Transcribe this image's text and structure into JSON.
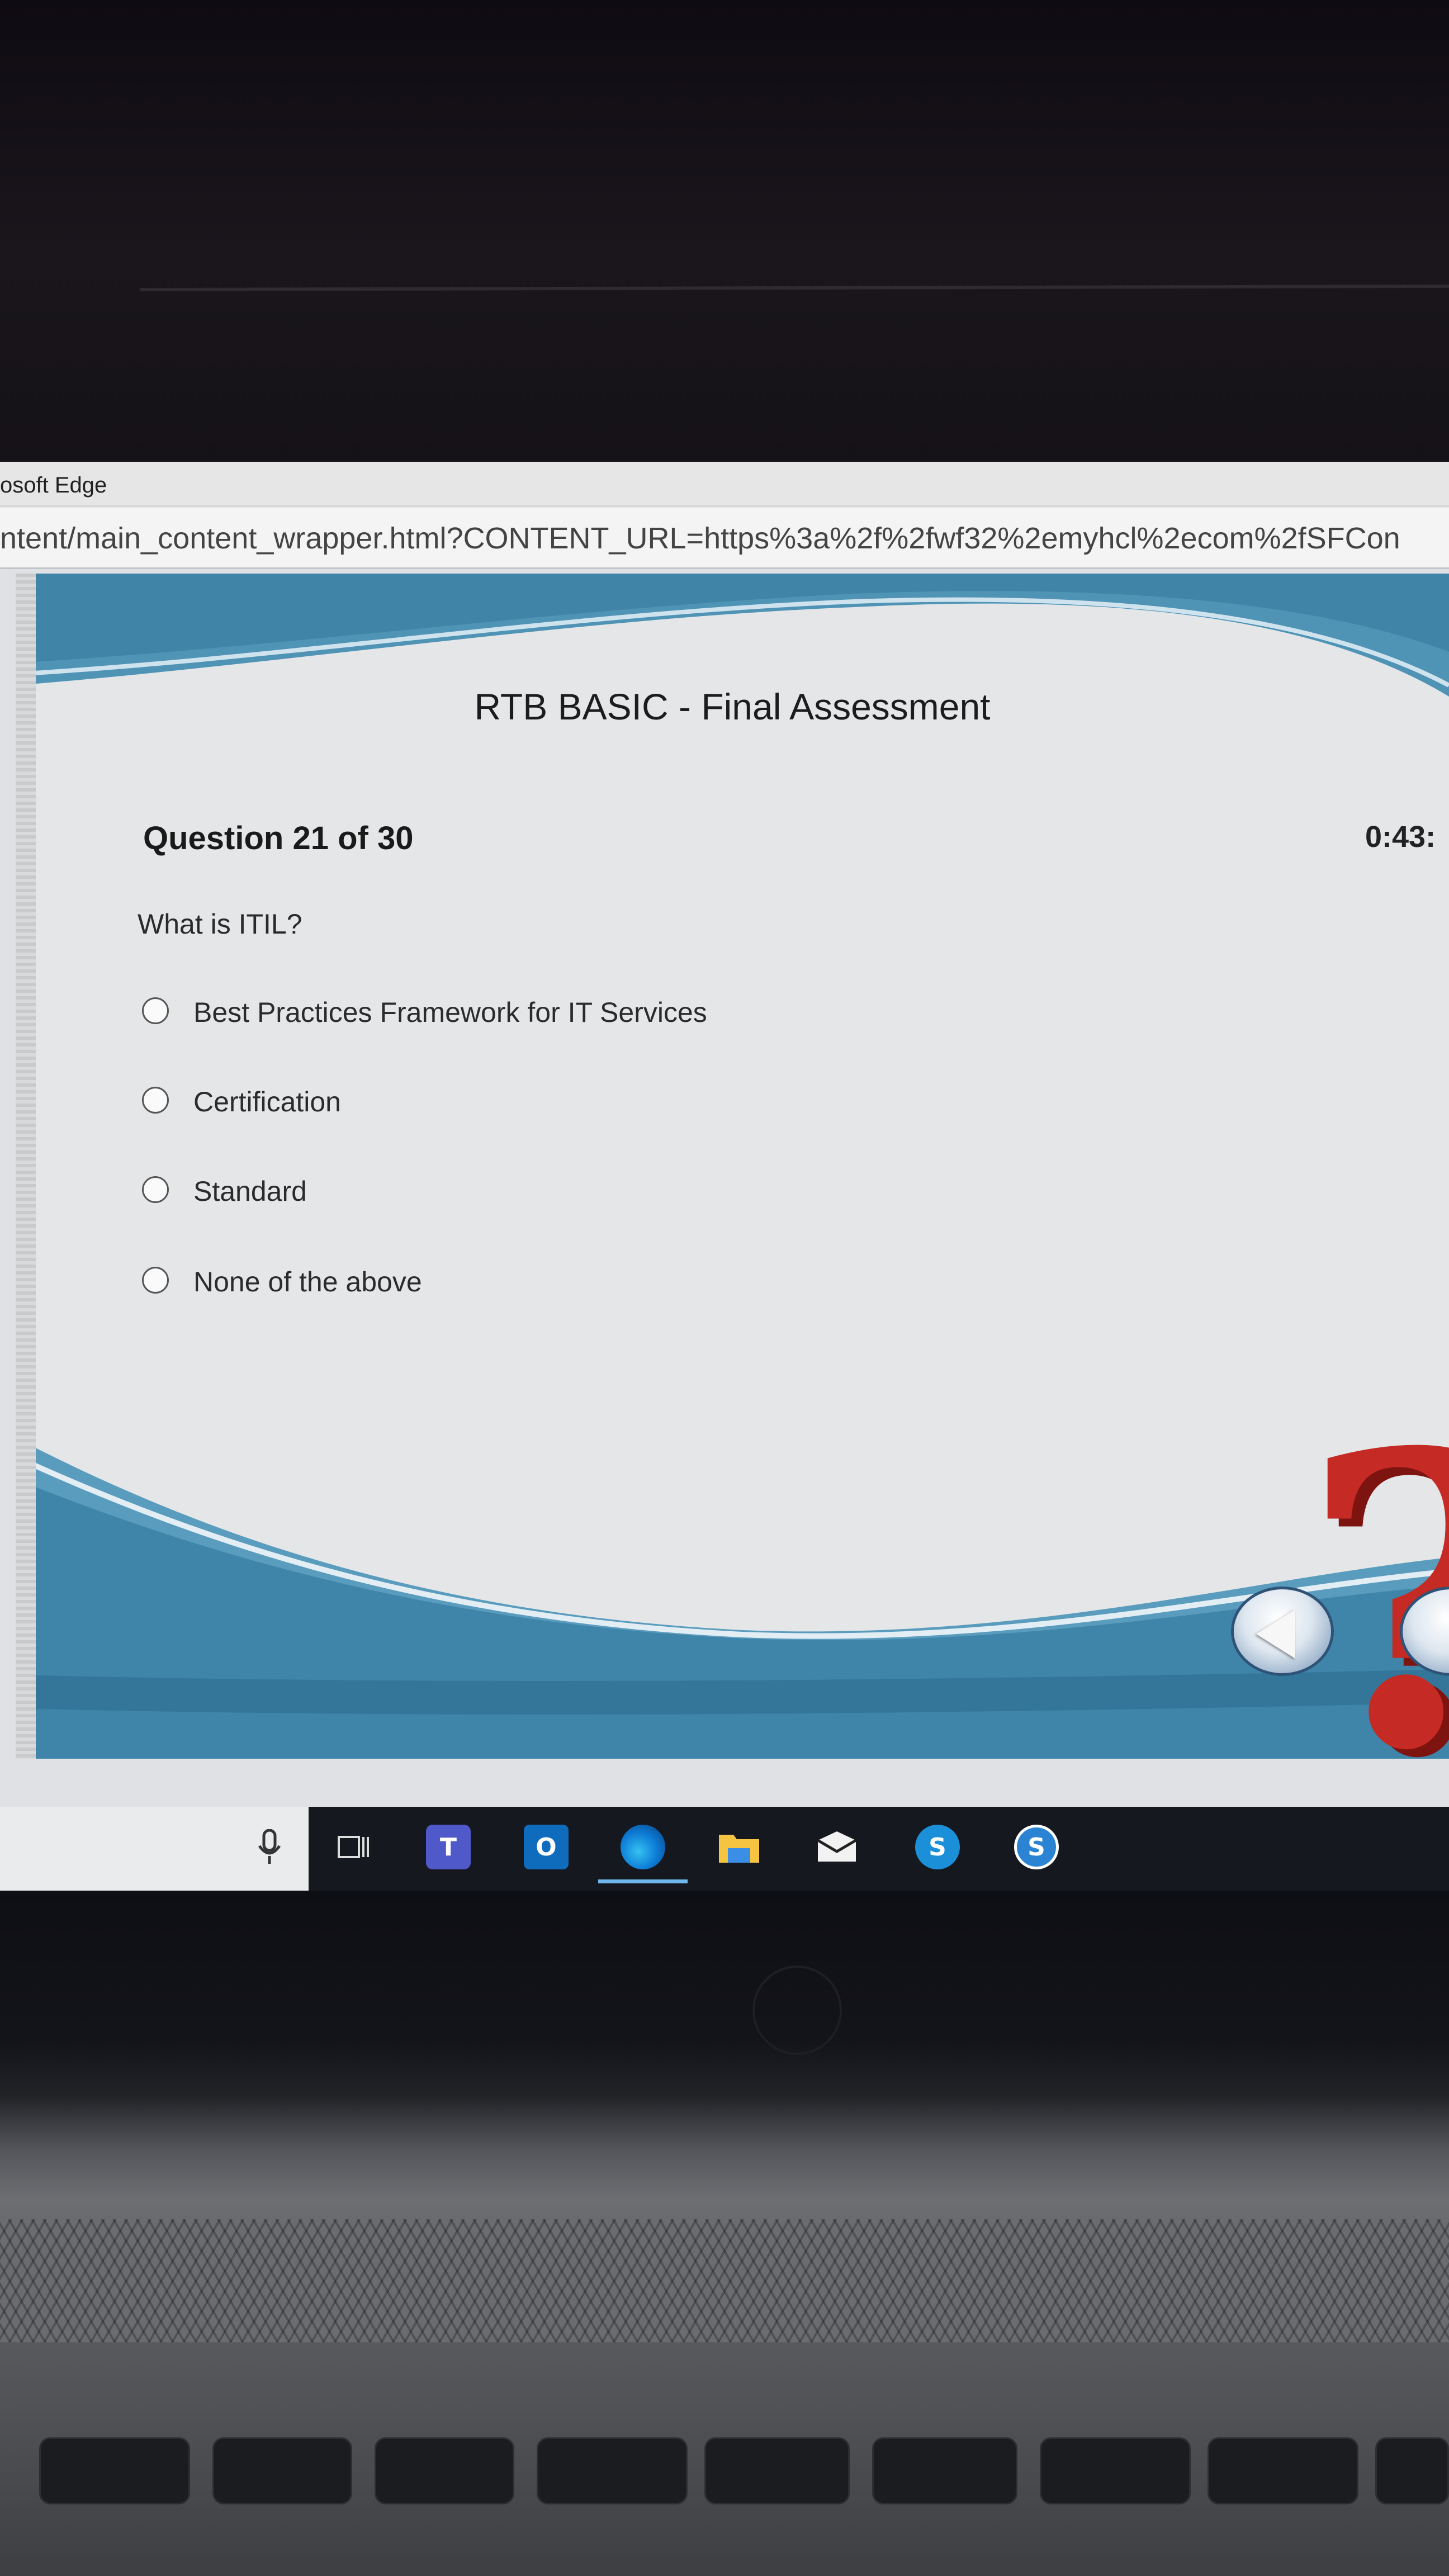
{
  "browser": {
    "title_fragment": "osoft Edge",
    "url_fragment": "ntent/main_content_wrapper.html?CONTENT_URL=https%3a%2f%2fwf32%2emyhcl%2ecom%2fSFCon"
  },
  "assessment": {
    "title": "RTB BASIC - Final Assessment",
    "question_counter": "Question 21 of 30",
    "timer": "0:43:",
    "question": "What is ITIL?",
    "answers": [
      {
        "label": "Best Practices Framework for IT Services",
        "selected": false
      },
      {
        "label": "Certification",
        "selected": false
      },
      {
        "label": "Standard",
        "selected": false
      },
      {
        "label": "None of the above",
        "selected": false
      }
    ]
  },
  "taskbar": {
    "icons": [
      "microphone-icon",
      "task-view-icon",
      "teams-icon",
      "outlook-icon",
      "edge-icon",
      "file-explorer-icon",
      "mail-icon",
      "skype-icon",
      "skype-business-icon"
    ],
    "teams_glyph": "T",
    "outlook_glyph": "O",
    "skype_glyph": "S",
    "skype_business_glyph": "S"
  },
  "colors": {
    "wave_blue": "#4f93b5",
    "question_mark_red": "#c62a24",
    "taskbar": "#15181f"
  }
}
